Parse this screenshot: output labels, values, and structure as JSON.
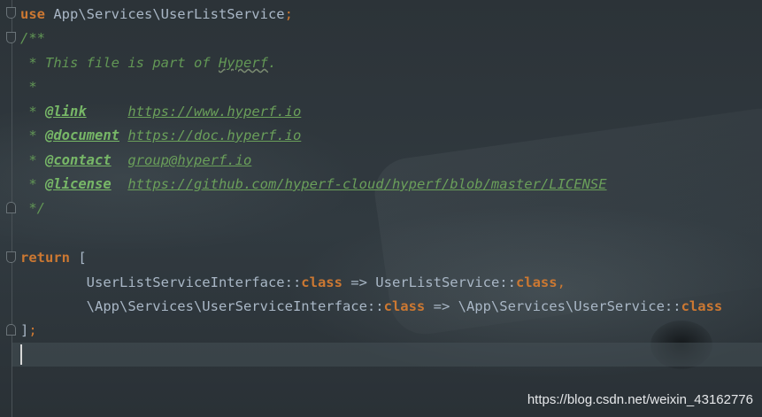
{
  "code": {
    "use_keyword": "use",
    "use_path": " App\\Services\\UserListService",
    "semicolon": ";",
    "doc_open": "/**",
    "doc_line1_prefix": " * This file is part of ",
    "doc_line1_word": "Hyperf",
    "doc_line1_suffix": ".",
    "doc_star": " *",
    "doc_tags": [
      {
        "prefix": " * ",
        "tag": "@link",
        "gap": "     ",
        "value": "https://www.hyperf.io"
      },
      {
        "prefix": " * ",
        "tag": "@document",
        "gap": " ",
        "value": "https://doc.hyperf.io"
      },
      {
        "prefix": " * ",
        "tag": "@contact",
        "gap": "  ",
        "value": "group@hyperf.io"
      },
      {
        "prefix": " * ",
        "tag": "@license",
        "gap": "  ",
        "value": "https://github.com/hyperf-cloud/hyperf/blob/master/LICENSE"
      }
    ],
    "doc_close": " */",
    "return_keyword": "return",
    "open_bracket": " [",
    "map_line1": {
      "indent": "        ",
      "iface": "UserListServiceInterface::",
      "class_kw": "class",
      "arrow": " => UserListService::",
      "class_kw2": "class",
      "comma": ","
    },
    "map_line2": {
      "indent": "        ",
      "iface": "\\App\\Services\\UserServiceInterface::",
      "class_kw": "class",
      "arrow": " => \\App\\Services\\UserService::",
      "class_kw2": "class"
    },
    "close_bracket": "]",
    "close_semicolon": ";"
  },
  "watermark": "https://blog.csdn.net/weixin_43162776"
}
